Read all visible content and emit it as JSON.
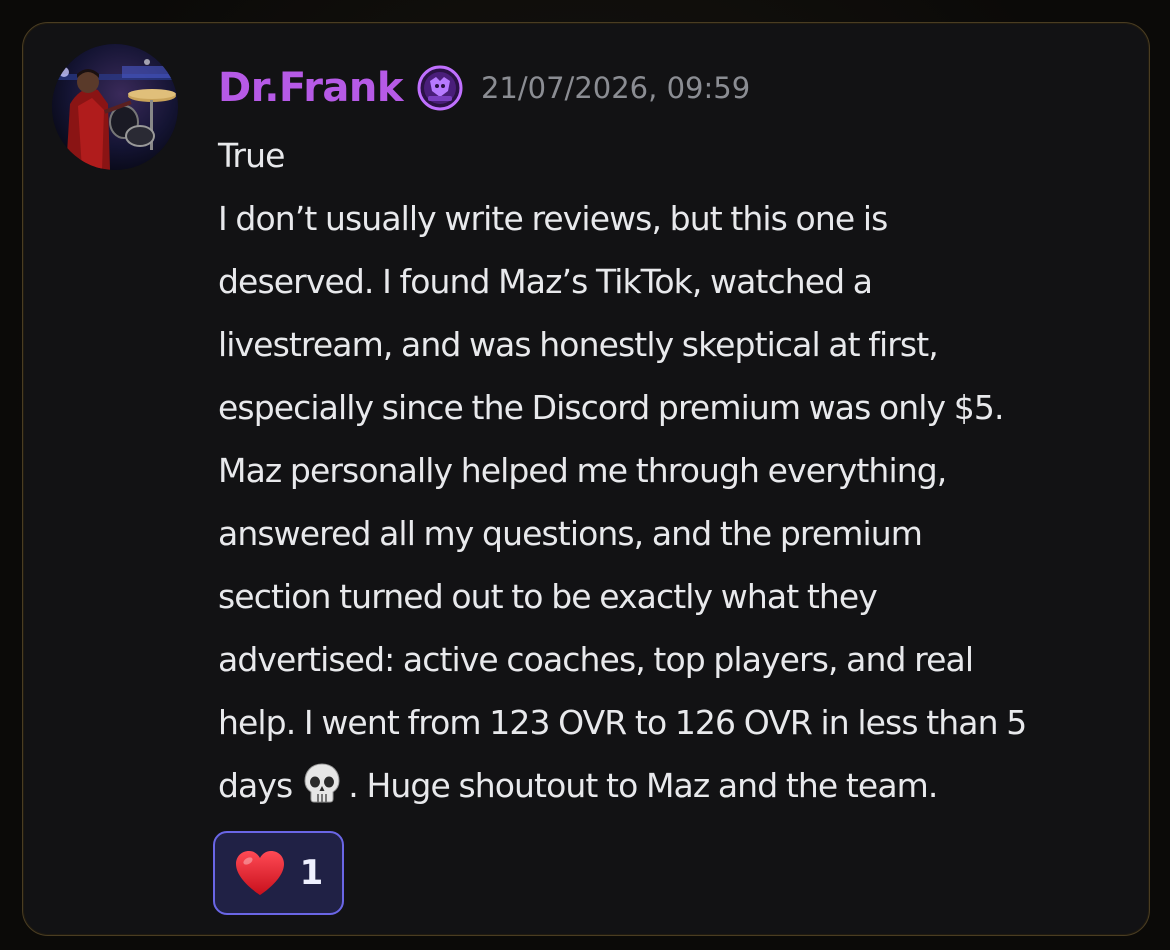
{
  "message": {
    "author": {
      "username": "Dr.Frank",
      "name_color": "#b65ae6",
      "avatar_icon": "drummer-photo",
      "badge_icon": "server-tag-badge"
    },
    "timestamp": "21/07/2026, 09:59",
    "lines": [
      "True",
      "I don’t usually write reviews, but this one is",
      "deserved. I found Maz’s TikTok, watched a",
      "livestream, and was honestly skeptical at first,",
      "especially since the Discord premium was only $5.",
      "Maz personally helped me through everything,",
      "answered all my questions, and the premium",
      "section turned out to be exactly what they",
      "advertised: active coaches, top players, and real",
      "help. I went from 123 OVR to 126 OVR in less than 5"
    ],
    "last_line": {
      "before_emoji": "days",
      "emoji": "skull",
      "after_emoji": ". Huge shoutout to Maz and the team."
    },
    "reactions": [
      {
        "emoji": "red-heart",
        "count": "1"
      }
    ]
  },
  "colors": {
    "background": "#121214",
    "border": "#4a3d22",
    "text": "#e8e9ec",
    "timestamp": "#8b8d93",
    "reaction_border": "#6a66e6",
    "reaction_bg": "#202145"
  }
}
